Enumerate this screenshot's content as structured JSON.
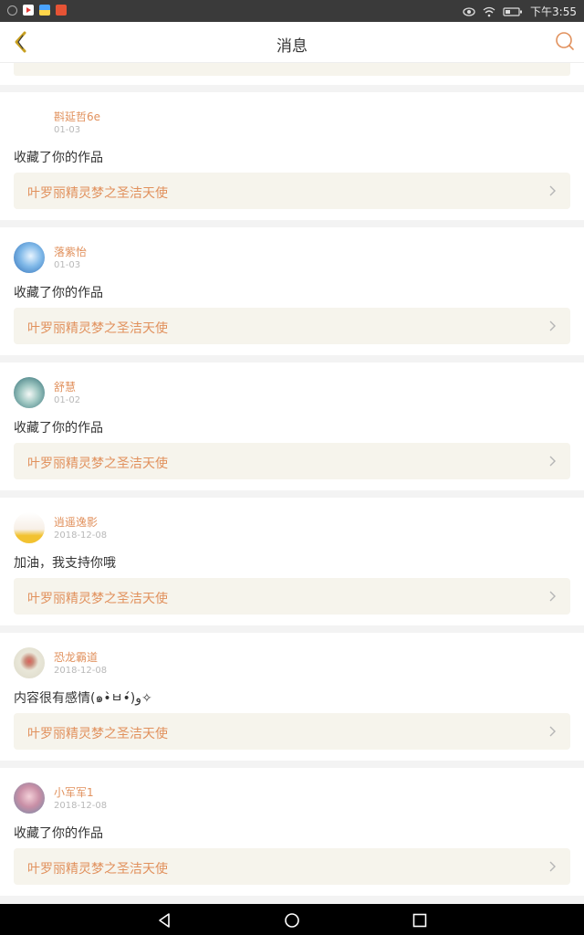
{
  "status_bar": {
    "time": "下午3:55",
    "icons": [
      "camera-icon",
      "youtube-icon",
      "app-icon",
      "news-icon",
      "eye-icon",
      "wifi-icon",
      "battery-icon"
    ]
  },
  "header": {
    "title": "消息",
    "back_icon": "back-chevron-icon",
    "search_icon": "search-icon"
  },
  "colors": {
    "accent": "#e1915d",
    "work_bg": "#f6f4ec",
    "text": "#333333",
    "date": "#b8b8b8"
  },
  "messages": [
    {
      "user": "斟延哲6e",
      "date": "01-03",
      "text": "收藏了你的作品",
      "work": "叶罗丽精灵梦之圣洁天使",
      "avatar": "none"
    },
    {
      "user": "落紫怡",
      "date": "01-03",
      "text": "收藏了你的作品",
      "work": "叶罗丽精灵梦之圣洁天使",
      "avatar": "blue"
    },
    {
      "user": "舒慧",
      "date": "01-02",
      "text": "收藏了你的作品",
      "work": "叶罗丽精灵梦之圣洁天使",
      "avatar": "teal"
    },
    {
      "user": "逍遥逸影",
      "date": "2018-12-08",
      "text": "加油，我支持你哦",
      "work": "叶罗丽精灵梦之圣洁天使",
      "avatar": "yellow"
    },
    {
      "user": "恐龙霸道",
      "date": "2018-12-08",
      "text": "内容很有感情(๑•̀ㅂ•́)و✧",
      "work": "叶罗丽精灵梦之圣洁天使",
      "avatar": "rose"
    },
    {
      "user": "小军军1",
      "date": "2018-12-08",
      "text": "收藏了你的作品",
      "work": "叶罗丽精灵梦之圣洁天使",
      "avatar": "pink"
    }
  ],
  "navbar": {
    "back_icon": "nav-back-icon",
    "home_icon": "nav-home-icon",
    "recent_icon": "nav-recent-icon"
  }
}
